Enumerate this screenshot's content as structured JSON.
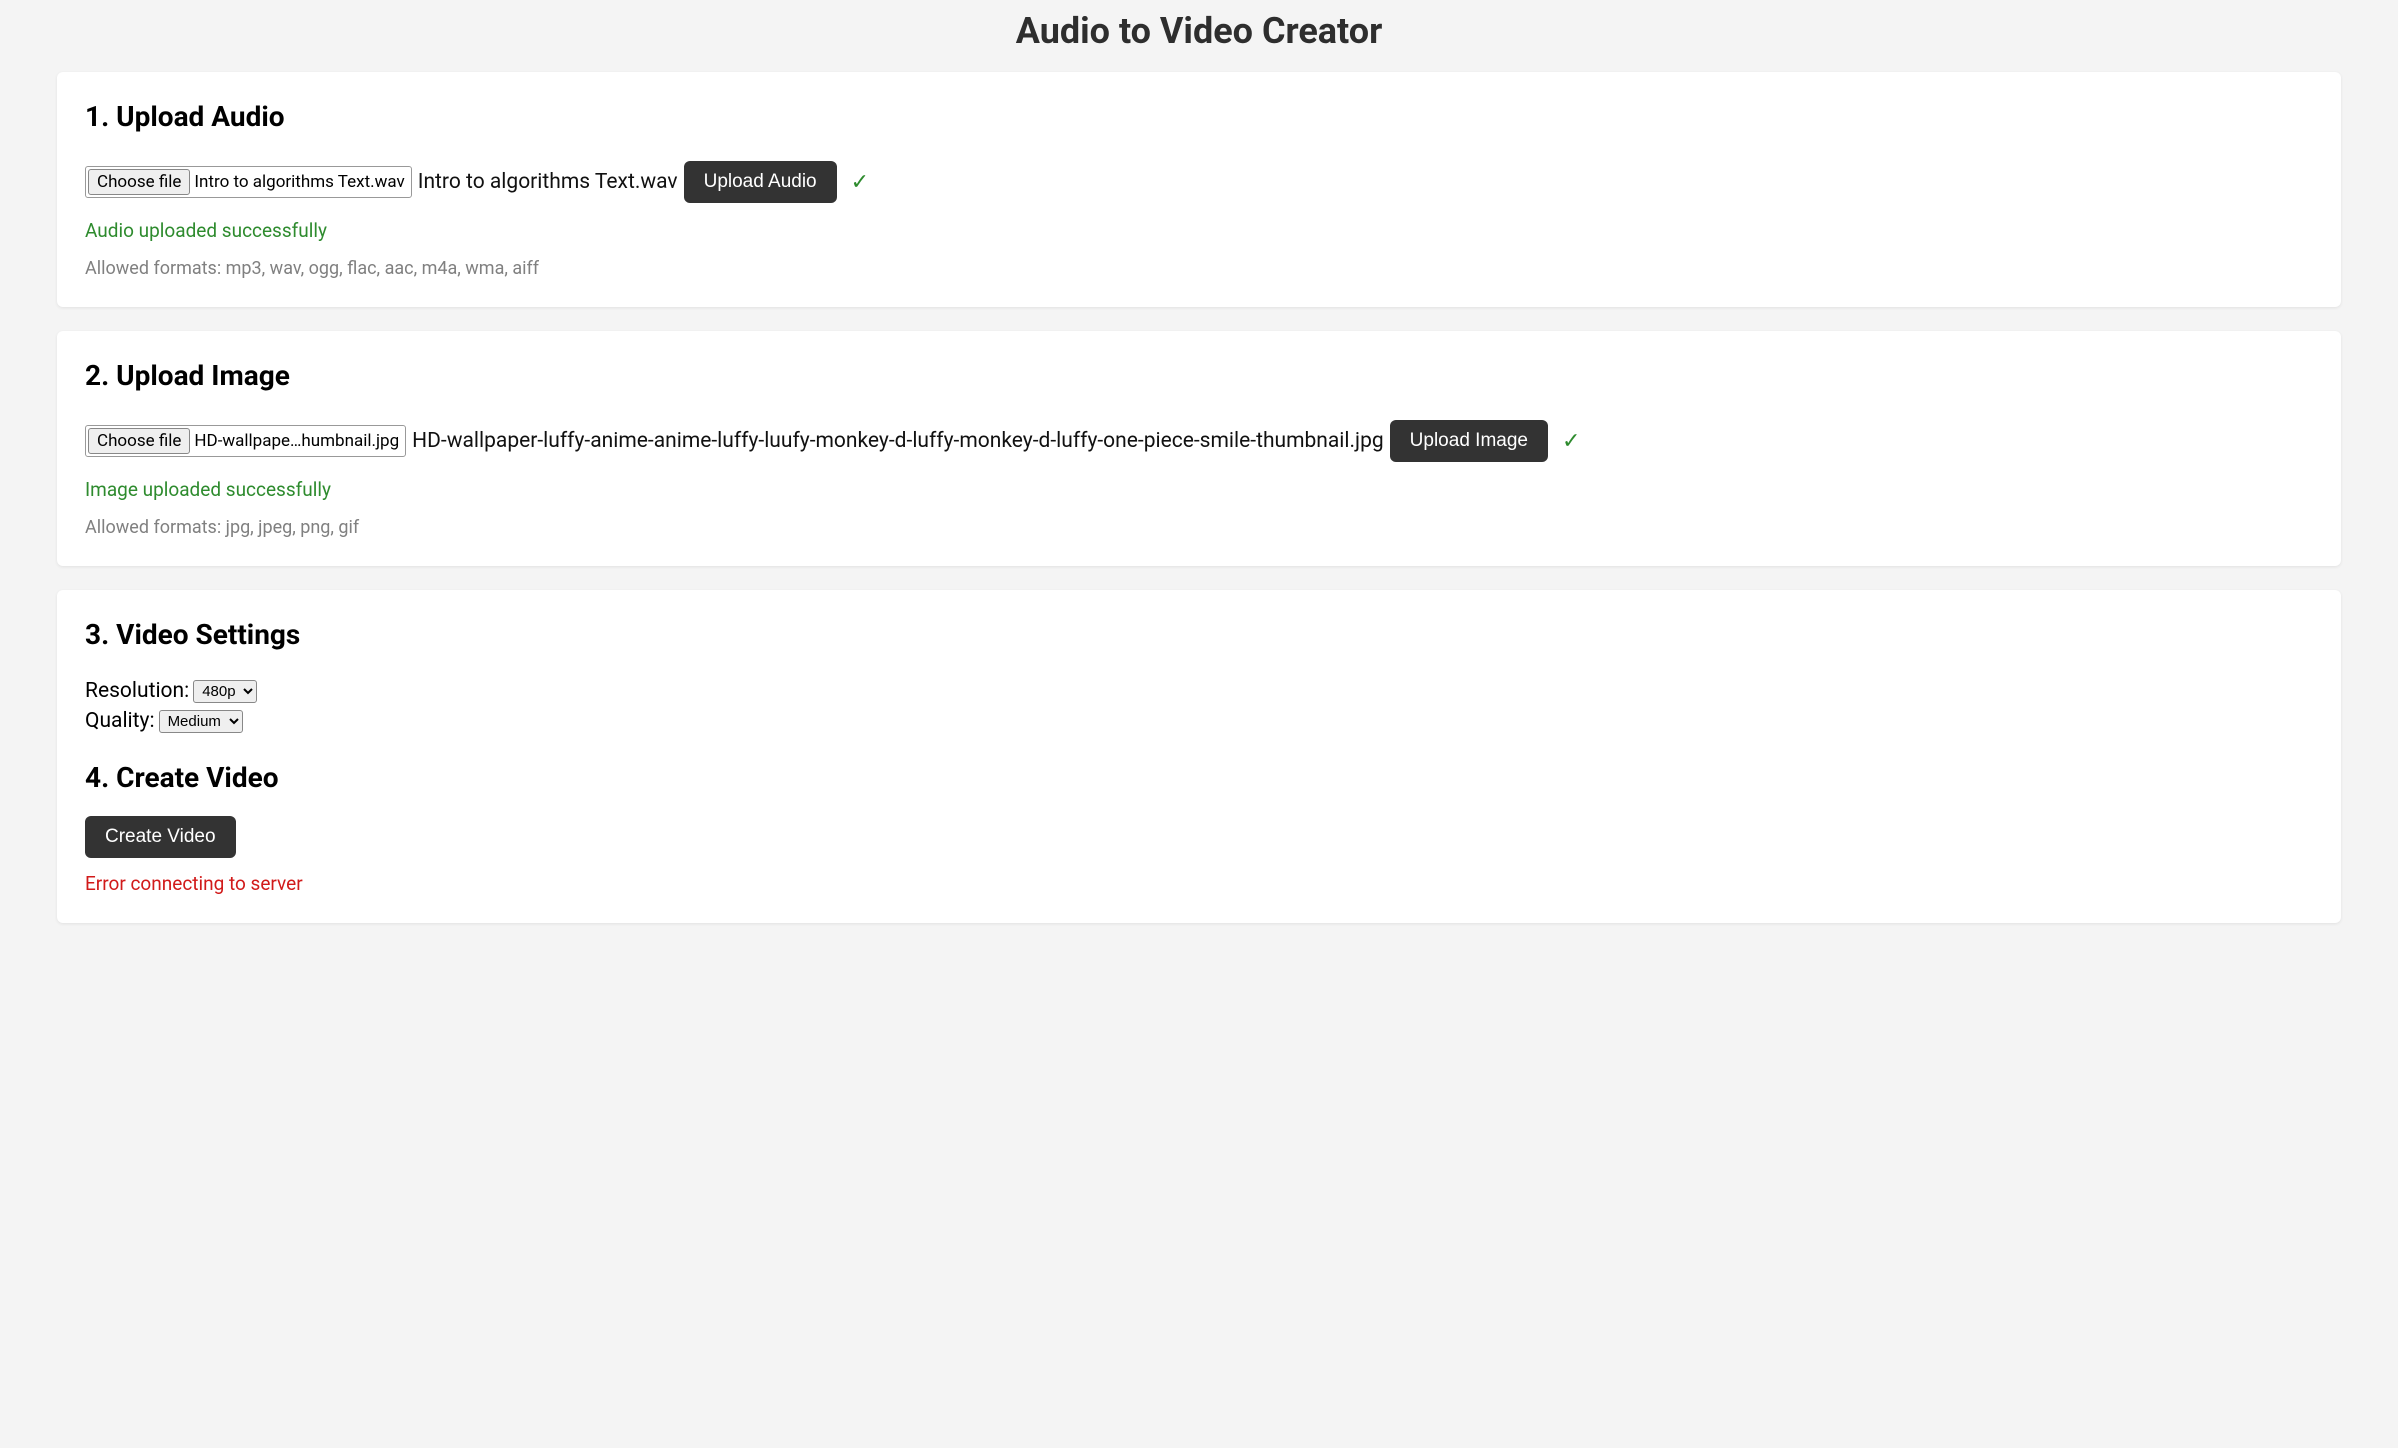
{
  "title": "Audio to Video Creator",
  "audio": {
    "heading": "1. Upload Audio",
    "choose_label": "Choose file",
    "input_filename": "Intro to algorithms Text.wav",
    "selected_filename": "Intro to algorithms Text.wav",
    "upload_button": "Upload Audio",
    "check": "✓",
    "success": "Audio uploaded successfully",
    "hint": "Allowed formats: mp3, wav, ogg, flac, aac, m4a, wma, aiff"
  },
  "image": {
    "heading": "2. Upload Image",
    "choose_label": "Choose file",
    "input_filename": "HD-wallpape…humbnail.jpg",
    "selected_filename": "HD-wallpaper-luffy-anime-anime-luffy-luufy-monkey-d-luffy-monkey-d-luffy-one-piece-smile-thumbnail.jpg",
    "upload_button": "Upload Image",
    "check": "✓",
    "success": "Image uploaded successfully",
    "hint": "Allowed formats: jpg, jpeg, png, gif"
  },
  "settings": {
    "heading": "3. Video Settings",
    "resolution_label": "Resolution:",
    "resolution_value": "480p",
    "quality_label": "Quality:",
    "quality_value": "Medium"
  },
  "create": {
    "heading": "4. Create Video",
    "button": "Create Video",
    "error": "Error connecting to server"
  }
}
